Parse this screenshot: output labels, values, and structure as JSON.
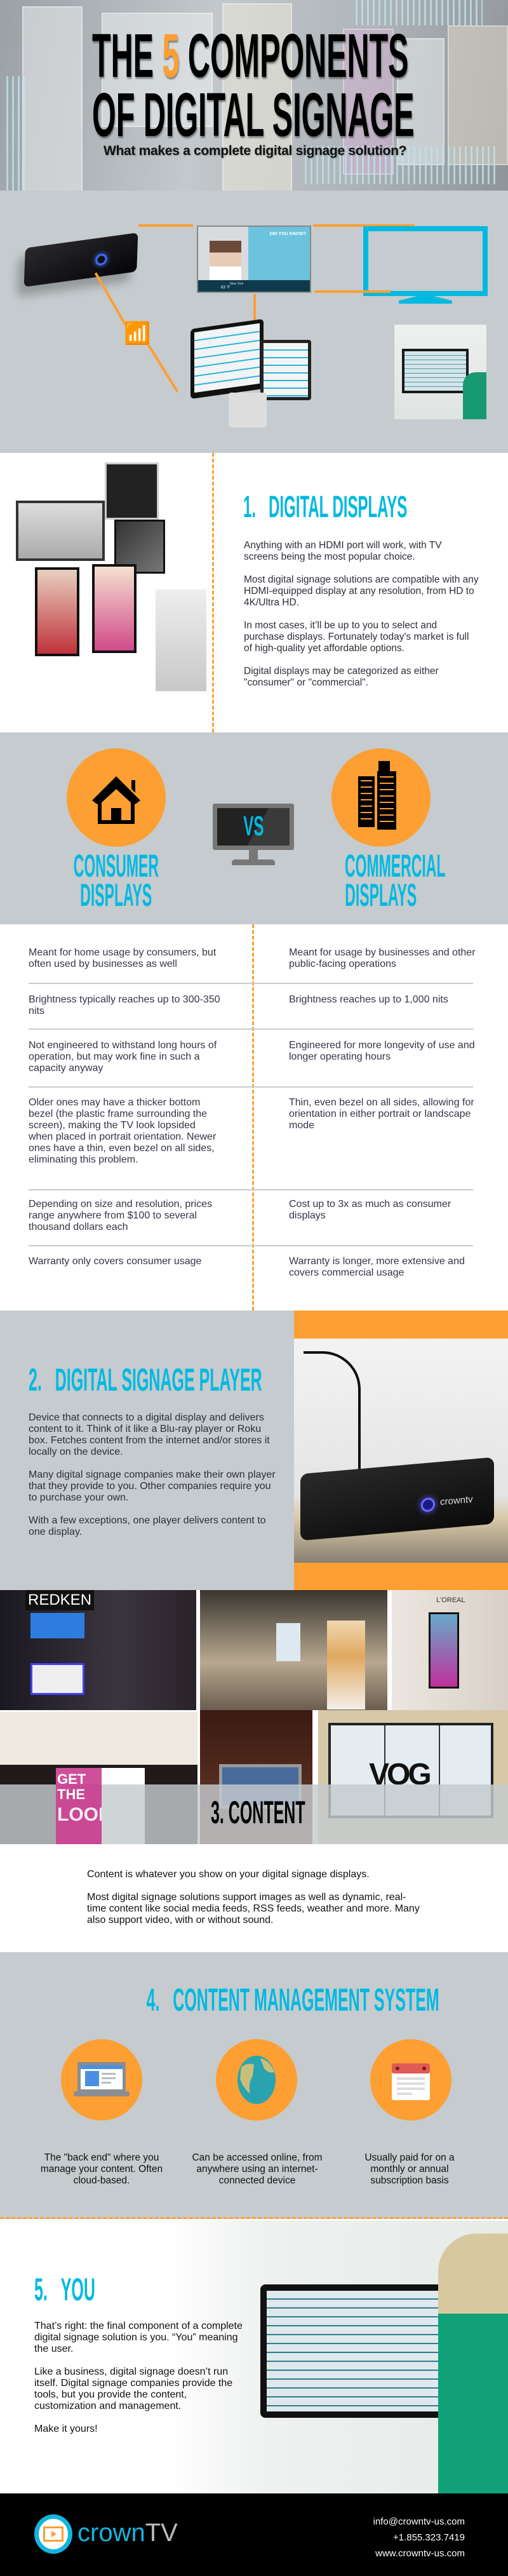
{
  "hero": {
    "title_pre": "THE ",
    "title_number": "5",
    "title_post": " COMPONENTS",
    "title_line2": "OF DIGITAL SIGNAGE",
    "subtitle": "What makes a complete digital signage solution?"
  },
  "diagram": {
    "screen_heading": "DID YOU KNOW?",
    "screen_city": "New York",
    "screen_temp": "63 °F",
    "player_brand": "crowntv"
  },
  "section1": {
    "heading_number": "1.",
    "heading": "DIGITAL DISPLAYS",
    "paragraphs": [
      "Anything with an HDMI port will work, with TV screens being the most popular choice.",
      "Most digital signage solutions are compatible with any HDMI-equipped display at any resolution, from HD to 4K/Ultra HD.",
      "In most cases, it’ll be up to you to select and purchase displays. Fortunately today's market is full of high-quality yet affordable options.",
      "Digital displays may be categorized as either \"consumer\" or \"commercial\"."
    ]
  },
  "compare": {
    "vs": "VS",
    "left_title": [
      "CONSUMER",
      "DISPLAYS"
    ],
    "right_title": [
      "COMMERCIAL",
      "DISPLAYS"
    ],
    "rows": [
      {
        "consumer": "Meant for home usage by consumers, but often used by businesses as well",
        "commercial": "Meant for usage by businesses and other public-facing operations"
      },
      {
        "consumer": "Brightness typically reaches up to 300-350 nits",
        "commercial": "Brightness reaches up to 1,000 nits"
      },
      {
        "consumer": "Not engineered to withstand long hours of operation, but may work fine in such a capacity anyway",
        "commercial": "Engineered for more longevity of use and longer operating hours"
      },
      {
        "consumer": "Older ones may have a thicker bottom bezel (the plastic frame surrounding the screen), making the TV look lopsided when placed in portrait orientation. Newer ones have a thin, even bezel on all sides, eliminating this problem.",
        "commercial": "Thin, even bezel on all sides, allowing for orientation in either portrait or landscape mode"
      },
      {
        "consumer": "Depending on size and resolution, prices range anywhere from $100 to several thousand dollars each",
        "commercial": "Cost up to 3x as much as consumer displays"
      },
      {
        "consumer": "Warranty only covers consumer usage",
        "commercial": "Warranty is longer, more extensive and covers commercial usage"
      }
    ]
  },
  "section2": {
    "heading_number": "2.",
    "heading": "DIGITAL SIGNAGE PLAYER",
    "paragraphs": [
      "Device that connects to a digital display and delivers content to it. Think of it like a Blu-ray player or Roku box. Fetches content from the internet and/or stores it locally on the device.",
      "Many digital signage companies make their own player that they provide to you. Other companies require you to purchase your own.",
      "With a few exceptions, one player delivers content to one display."
    ],
    "player_brand": "crowntv"
  },
  "section3": {
    "heading": "3. CONTENT",
    "photo_labels": {
      "redken": "REDKEN",
      "loreal": "L'OREAL",
      "get_the_look": [
        "GET THE",
        "LOOK"
      ],
      "vog": "VOG"
    },
    "paragraphs": [
      "Content is whatever you show on your digital signage displays.",
      "Most digital signage solutions support images as well as dynamic, real-time content like social media feeds, RSS feeds, weather and more. Many also support video, with or without sound."
    ]
  },
  "section4": {
    "heading_number": "4.",
    "heading": "CONTENT MANAGEMENT SYSTEM",
    "features": [
      {
        "icon": "laptop-icon",
        "text": "The \"back end\" where you manage your content. Often cloud-based."
      },
      {
        "icon": "globe-icon",
        "text": "Can be accessed online, from anywhere using an internet-connected device"
      },
      {
        "icon": "calendar-icon",
        "text": "Usually paid for on a monthly or annual subscription basis"
      }
    ]
  },
  "section5": {
    "heading_number": "5.",
    "heading": "YOU",
    "paragraphs": [
      "That’s right: the final component of a complete digital signage solution is you. “You” meaning the user.",
      "Like a business, digital signage doesn’t run itself. Digital signage companies provide the tools, but you provide the content, customization and management.",
      "Make it yours!"
    ]
  },
  "footer": {
    "logo_text_a": "crown",
    "logo_text_b": "TV",
    "email": "info@crowntv-us.com",
    "phone": "+1.855.323.7419",
    "website": "www.crowntv-us.com"
  },
  "colors": {
    "orange": "#fd9f32",
    "cyan": "#00b9e0",
    "gray": "#c5cbce",
    "footer": "#000000"
  }
}
